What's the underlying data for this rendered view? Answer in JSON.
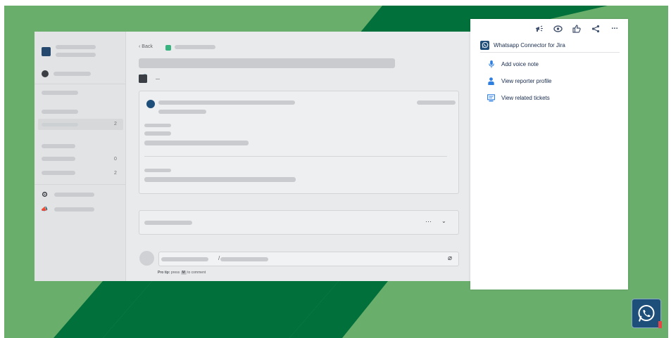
{
  "jira": {
    "back_label": "Back",
    "sidebar_counts": [
      "2",
      "0",
      "2"
    ],
    "pro_tip_prefix": "Pro tip:",
    "pro_tip_mid": "press",
    "pro_tip_key": "M",
    "pro_tip_suffix": "to comment",
    "comment_separator": "/"
  },
  "panel": {
    "title": "Whatsapp Connector for Jira",
    "toolbar": [
      {
        "icon": "megaphone-icon"
      },
      {
        "icon": "eye-icon"
      },
      {
        "icon": "thumbs-up-icon"
      },
      {
        "icon": "share-icon"
      },
      {
        "icon": "more-icon",
        "label": "···"
      }
    ],
    "items": [
      {
        "icon": "microphone-icon",
        "label": "Add voice note",
        "color": "#2f7fe0"
      },
      {
        "icon": "user-icon",
        "label": "View reporter profile",
        "color": "#2f7fe0"
      },
      {
        "icon": "monitor-icon",
        "label": "View related tickets",
        "color": "#2f7fe0"
      }
    ]
  },
  "colors": {
    "bg_green": "#6aae6c",
    "stripe_dark": "#01703a",
    "brand_navy": "#1e4f7a"
  }
}
